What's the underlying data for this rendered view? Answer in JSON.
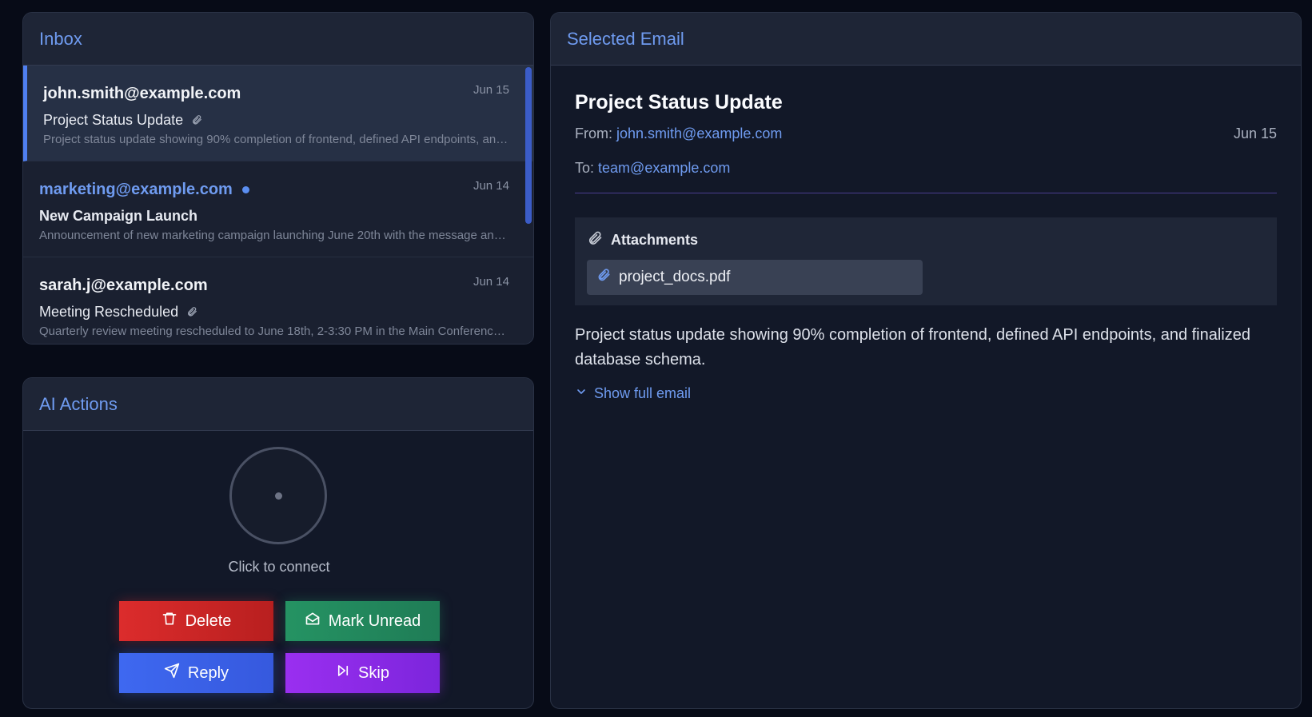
{
  "inbox": {
    "title": "Inbox",
    "emails": [
      {
        "sender": "john.smith@example.com",
        "date": "Jun 15",
        "subject": "Project Status Update",
        "preview": "Project status update showing 90% completion of frontend, defined API endpoints, and finalized database schema.",
        "has_attachment": true,
        "unread": false,
        "selected": true
      },
      {
        "sender": "marketing@example.com",
        "date": "Jun 14",
        "subject": "New Campaign Launch",
        "preview": "Announcement of new marketing campaign launching June 20th with the message and assets ready.",
        "has_attachment": false,
        "unread": true,
        "selected": false
      },
      {
        "sender": "sarah.j@example.com",
        "date": "Jun 14",
        "subject": "Meeting Rescheduled",
        "preview": "Quarterly review meeting rescheduled to June 18th, 2-3:30 PM in the Main Conference Room.",
        "has_attachment": true,
        "unread": false,
        "selected": false
      }
    ]
  },
  "ai_actions": {
    "title": "AI Actions",
    "connect_label": "Click to connect",
    "buttons": {
      "delete": "Delete",
      "mark_unread": "Mark Unread",
      "reply": "Reply",
      "skip": "Skip"
    }
  },
  "selected_email": {
    "panel_title": "Selected Email",
    "subject": "Project Status Update",
    "from_label": "From:",
    "from": "john.smith@example.com",
    "date": "Jun 15",
    "to_label": "To:",
    "to": "team@example.com",
    "attachments_label": "Attachments",
    "attachment_file": "project_docs.pdf",
    "body": "Project status update showing 90% completion of frontend, defined API endpoints, and finalized database schema.",
    "show_full_label": "Show full email"
  },
  "colors": {
    "accent": "#6f9bf0",
    "delete": "#dc2c2c",
    "mark_unread": "#259363",
    "reply": "#3e68f0",
    "skip": "#9a2ff0"
  }
}
